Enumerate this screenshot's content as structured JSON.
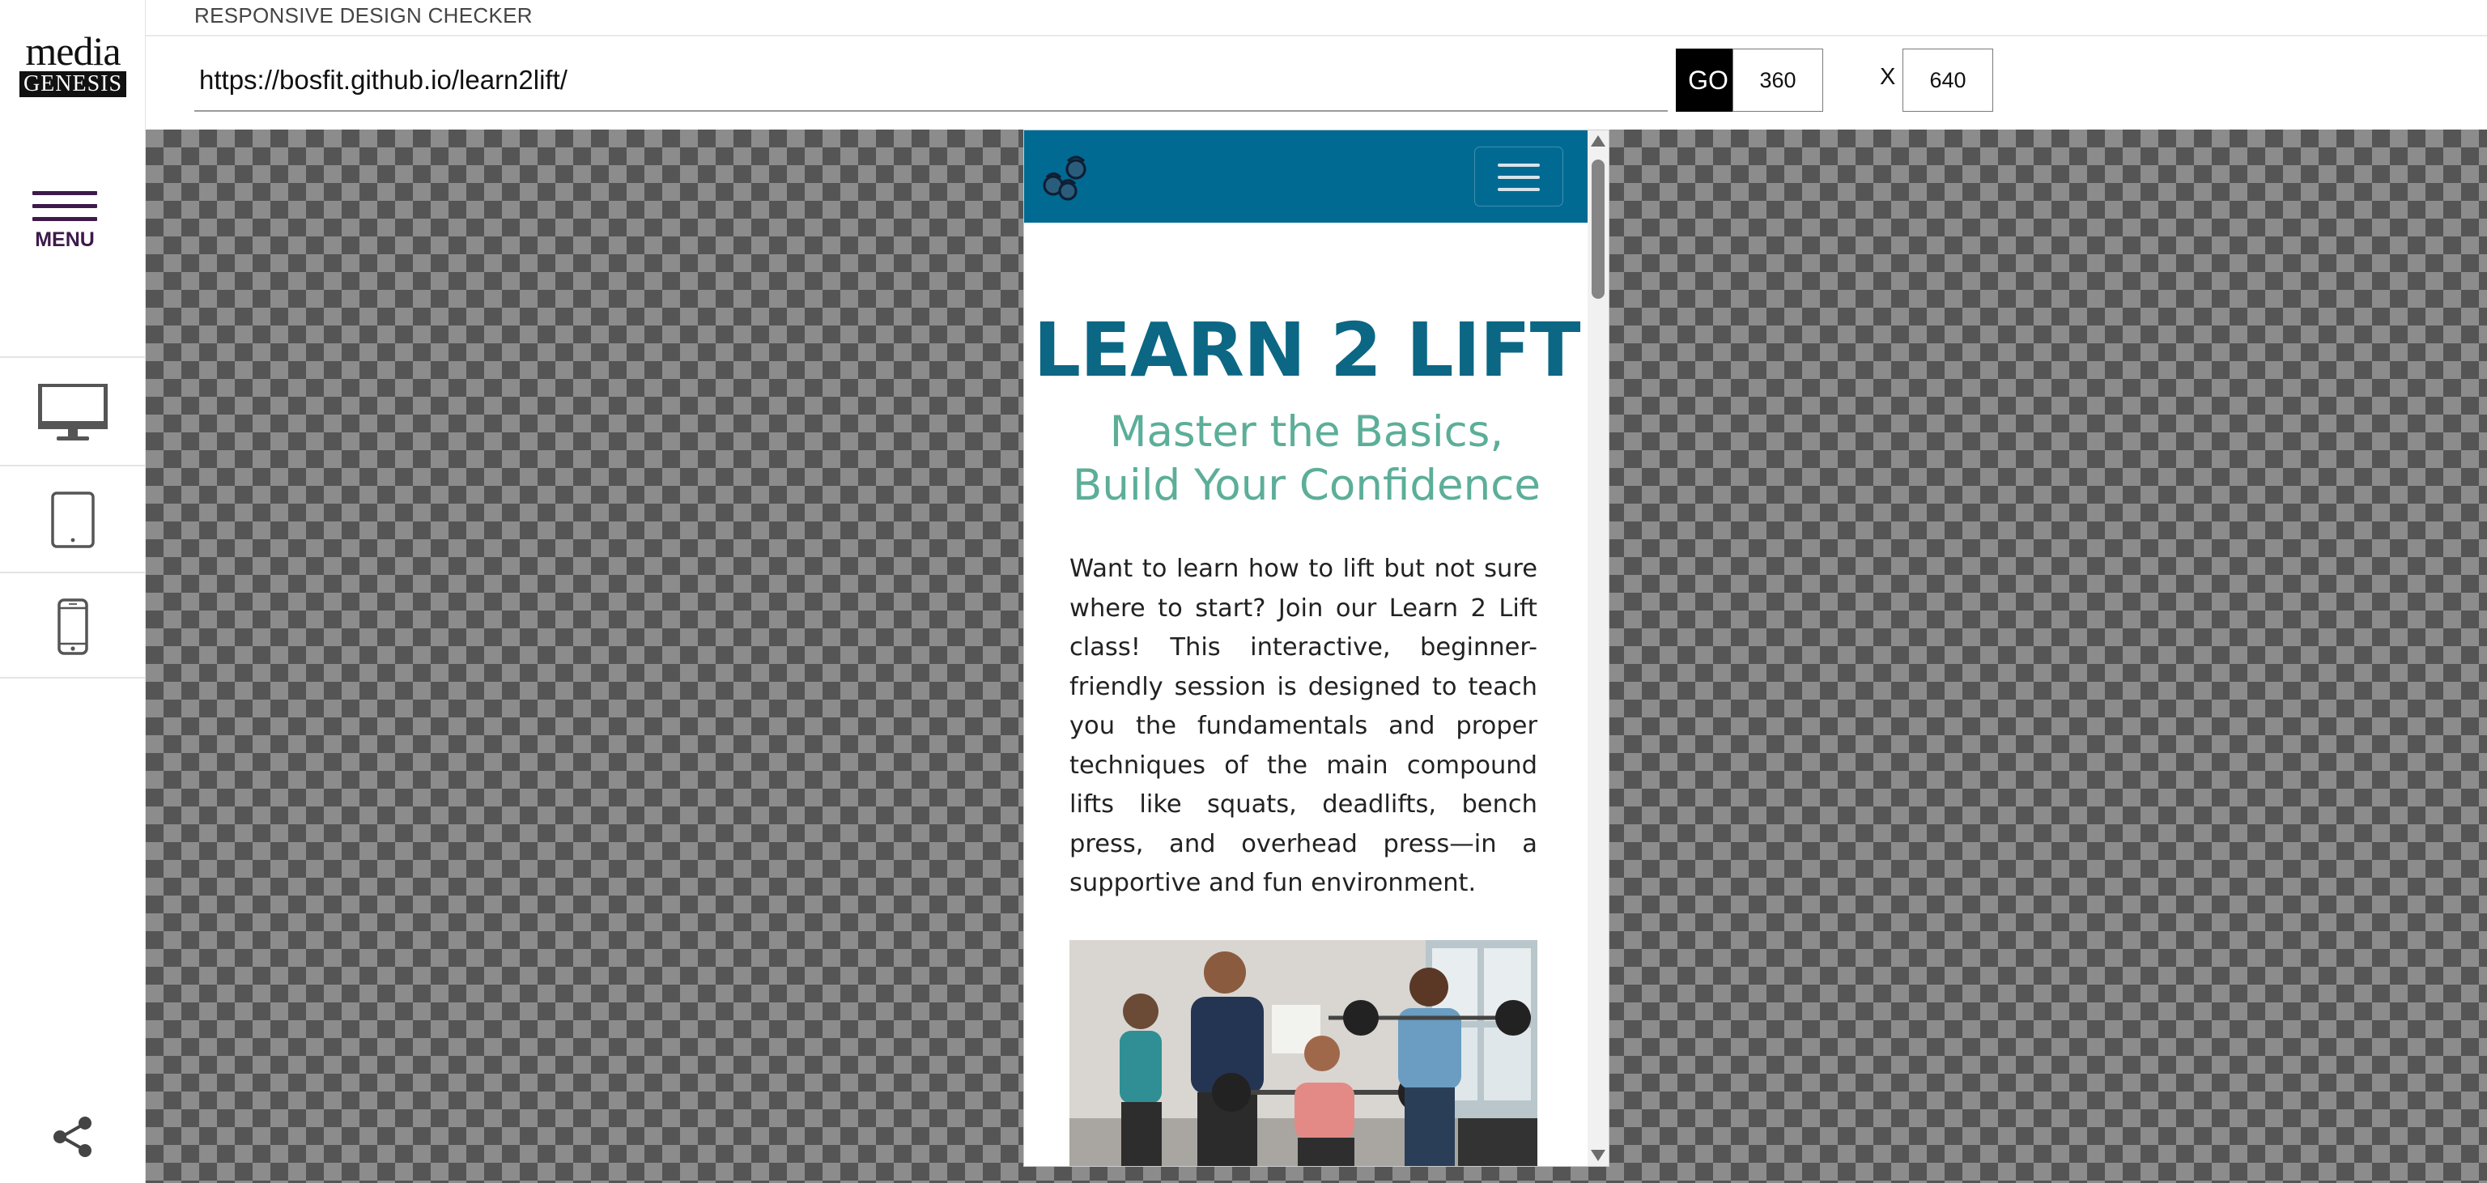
{
  "app": {
    "title": "RESPONSIVE DESIGN CHECKER"
  },
  "logo": {
    "line1": "media",
    "line2": "GENESIS"
  },
  "sidebar": {
    "menu_label": "MENU",
    "devices": [
      {
        "name": "desktop",
        "icon": "desktop-monitor-icon"
      },
      {
        "name": "tablet",
        "icon": "tablet-icon"
      },
      {
        "name": "mobile",
        "icon": "mobile-phone-icon"
      }
    ],
    "share_icon": "share-icon"
  },
  "toolbar": {
    "url": "https://bosfit.github.io/learn2lift/",
    "go_label": "GO",
    "width": "360",
    "x_label": "X",
    "height": "640"
  },
  "preview": {
    "nav": {
      "bg_color": "#006a93",
      "brand_icon": "kettlebells-icon",
      "toggle_icon": "hamburger-icon"
    },
    "title": "LEARN 2 LIFT",
    "subtitle_line1": "Master the Basics,",
    "subtitle_line2": "Build Your Confidence",
    "body": "Want to learn how to lift but not sure where to start? Join our Learn 2 Lift class! This interactive, beginner-friendly session is designed to teach you the fundamentals and proper techniques of the main compound lifts like squats, deadlifts, bench press, and overhead press—in a supportive and fun environment."
  },
  "colors": {
    "menu_purple": "#3d1a4b",
    "title_blue": "#0b6784",
    "subtitle_green": "#5cae98"
  }
}
